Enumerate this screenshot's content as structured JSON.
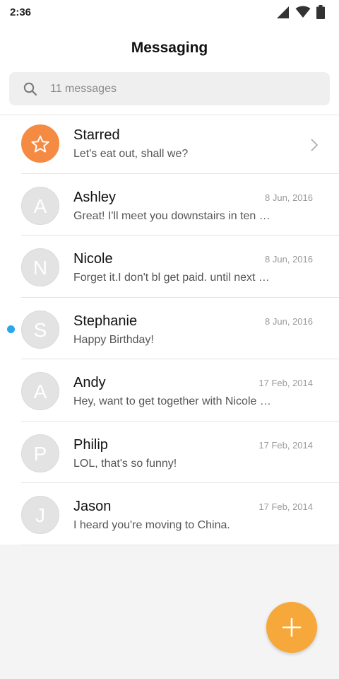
{
  "status_bar": {
    "time": "2:36",
    "icons": [
      "signal-icon",
      "wifi-icon",
      "battery-icon"
    ]
  },
  "header": {
    "title": "Messaging"
  },
  "search": {
    "placeholder": "11 messages",
    "value": ""
  },
  "colors": {
    "starred_accent": "#f58a42",
    "fab": "#f7a83a",
    "unread_dot": "#2aa7e8"
  },
  "starred": {
    "name": "Starred",
    "preview": "Let's eat out, shall we?"
  },
  "conversations": [
    {
      "initial": "A",
      "name": "Ashley",
      "date": "8 Jun, 2016",
      "preview": "Great! I'll meet you downstairs in ten …",
      "unread": false
    },
    {
      "initial": "N",
      "name": "Nicole",
      "date": "8 Jun, 2016",
      "preview": "Forget it.I don't bl get paid. until next F…",
      "unread": false
    },
    {
      "initial": "S",
      "name": "Stephanie",
      "date": "8 Jun, 2016",
      "preview": "Happy Birthday!",
      "unread": true
    },
    {
      "initial": "A",
      "name": "Andy",
      "date": "17 Feb, 2014",
      "preview": "Hey, want to get together with Nicole …",
      "unread": false
    },
    {
      "initial": "P",
      "name": "Philip",
      "date": "17 Feb, 2014",
      "preview": "LOL, that's so funny!",
      "unread": false
    },
    {
      "initial": "J",
      "name": "Jason",
      "date": "17 Feb, 2014",
      "preview": "I heard you're moving to China.",
      "unread": false
    }
  ],
  "fab": {
    "icon": "plus-icon"
  }
}
